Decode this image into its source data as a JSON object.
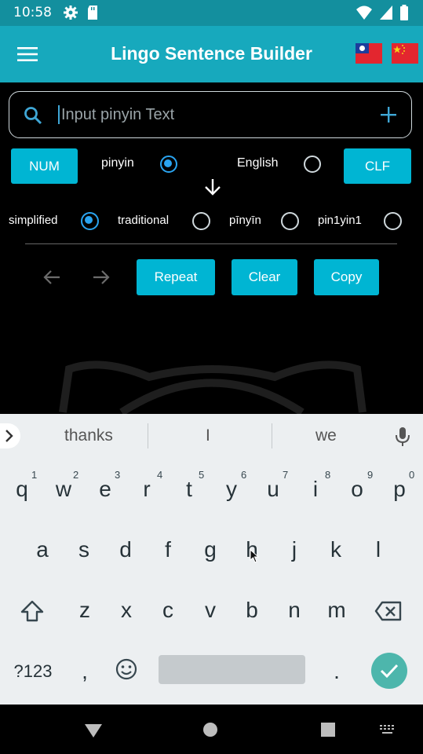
{
  "status_bar": {
    "time": "10:58",
    "icons": [
      "gear-icon",
      "sd-card-icon",
      "wifi-icon",
      "signal-icon",
      "battery-icon"
    ]
  },
  "app_bar": {
    "title": "Lingo Sentence Builder",
    "flags": [
      "taiwan-flag-icon",
      "china-flag-icon"
    ]
  },
  "search": {
    "placeholder": "Input pinyin Text"
  },
  "options_row1": {
    "num_button": "NUM",
    "pinyin_label": "pinyin",
    "english_label": "English",
    "clf_button": "CLF"
  },
  "options_row2": {
    "simplified": "simplified",
    "traditional": "traditional",
    "pinyin_tones": "pīnyīn",
    "pinyin_numbers": "pin1yin1"
  },
  "actions": {
    "repeat": "Repeat",
    "clear": "Clear",
    "copy": "Copy"
  },
  "keyboard": {
    "suggestions": [
      "thanks",
      "I",
      "we"
    ],
    "row1": [
      "q",
      "w",
      "e",
      "r",
      "t",
      "y",
      "u",
      "i",
      "o",
      "p"
    ],
    "row1_hints": [
      "1",
      "2",
      "3",
      "4",
      "5",
      "6",
      "7",
      "8",
      "9",
      "0"
    ],
    "row2": [
      "a",
      "s",
      "d",
      "f",
      "g",
      "h",
      "j",
      "k",
      "l"
    ],
    "row3": [
      "z",
      "x",
      "c",
      "v",
      "b",
      "n",
      "m"
    ],
    "symbols_key": "?123",
    "comma": ",",
    "period": "."
  },
  "colors": {
    "app_bar": "#17a9bd",
    "status_bar": "#138f9e",
    "button": "#00b5d3",
    "radio_selected": "#2aa4f0",
    "enter_key": "#4db6ac"
  }
}
